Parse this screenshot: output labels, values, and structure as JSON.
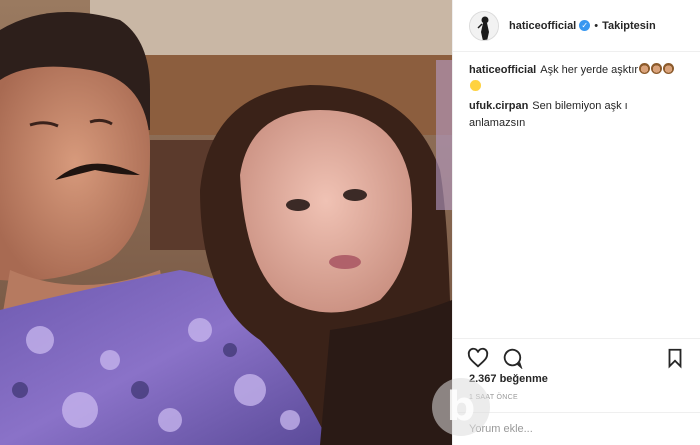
{
  "header": {
    "username": "haticeofficial",
    "separator": "•",
    "follow_label": "Takiptesin"
  },
  "comments": [
    {
      "user": "haticeofficial",
      "text": "Aşk her yerde aşktır",
      "emojis": [
        "monkey",
        "monkey",
        "monkey",
        "smile"
      ]
    },
    {
      "user": "ufuk.cirpan",
      "text": "Sen bilemiyon aşk ı anlamazsın"
    }
  ],
  "actions": {
    "like_icon": "heart-icon",
    "comment_icon": "comment-icon",
    "save_icon": "bookmark-icon"
  },
  "likes": "2.367 beğenme",
  "time": "1 SAAT ÖNCE",
  "add_comment": {
    "placeholder": "Yorum ekle..."
  },
  "colors": {
    "verified": "#3897f0",
    "border": "#efefef",
    "muted": "#999999"
  }
}
